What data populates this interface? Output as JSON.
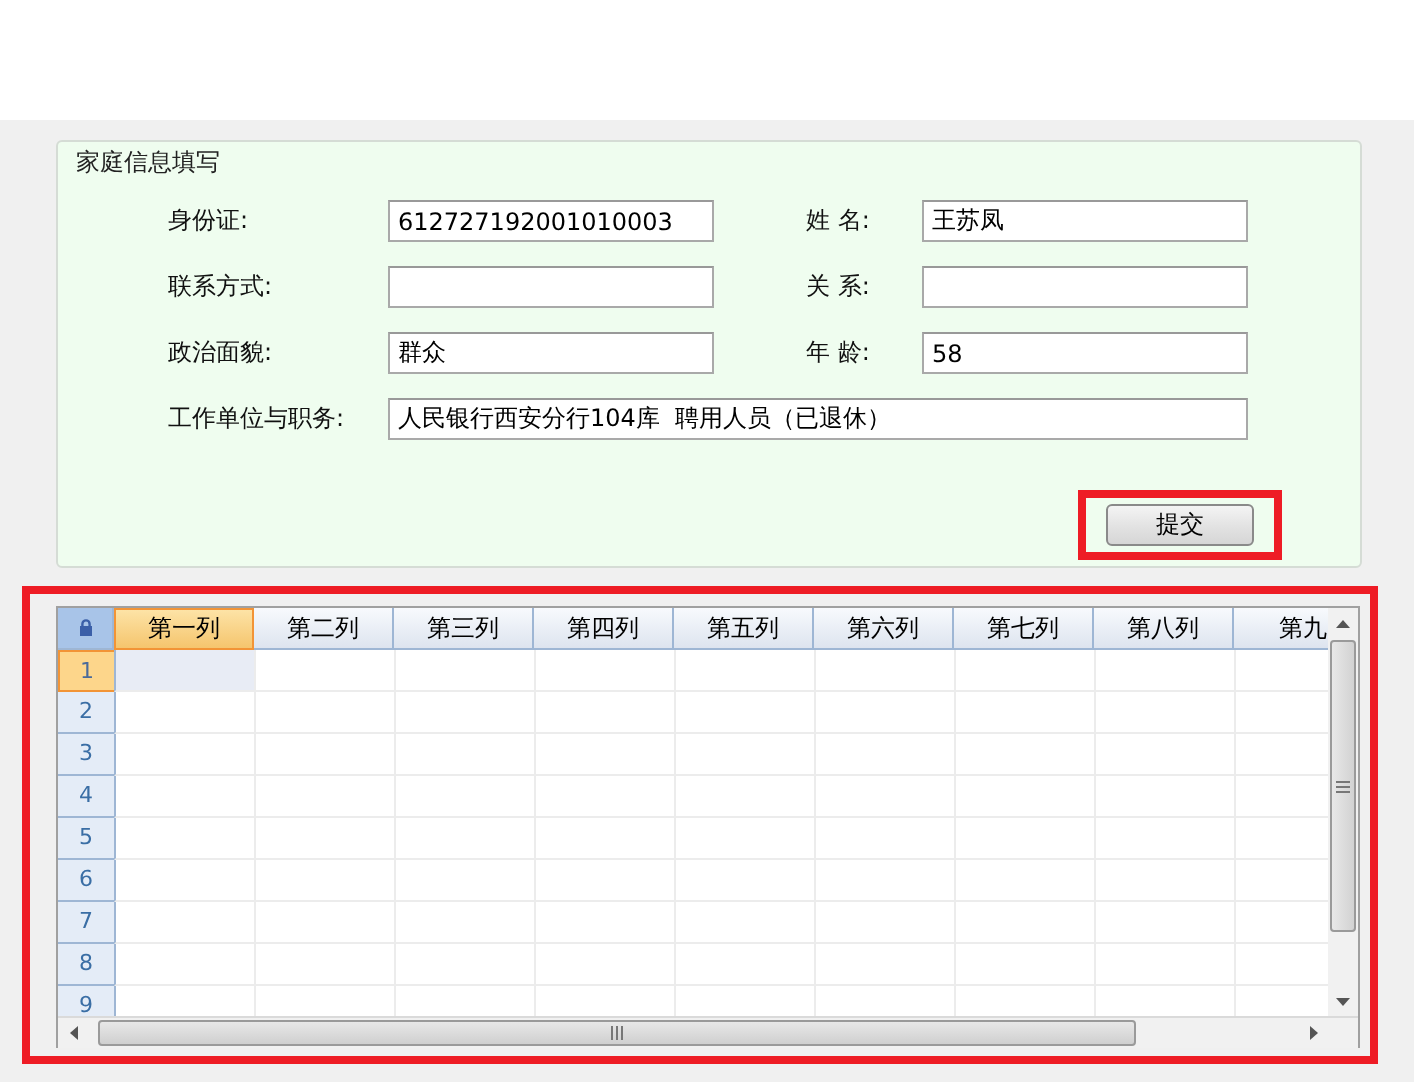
{
  "form": {
    "title": "家庭信息填写",
    "fields": [
      {
        "label": "身份证:",
        "value": "612727192001010003",
        "kind": "half"
      },
      {
        "label": "姓 名:",
        "value": "王苏凤",
        "kind": "half"
      },
      {
        "label": "联系方式:",
        "kind": "half"
      },
      {
        "label": "关 系:",
        "kind": "half"
      },
      {
        "label": "政治面貌:",
        "value": "群众",
        "kind": "half"
      },
      {
        "label": "年 龄:",
        "value": "58",
        "kind": "half"
      },
      {
        "label": "工作单位与职务:",
        "value": "人民银行西安分行104库  聘用人员（已退休）",
        "kind": "full"
      }
    ],
    "submit": {
      "label": "提交",
      "highlighted": true
    }
  },
  "grid": {
    "highlighted": true,
    "columns": [
      {
        "label": "第一列",
        "selected": true
      },
      {
        "label": "第二列",
        "selected": false
      },
      {
        "label": "第三列",
        "selected": false
      },
      {
        "label": "第四列",
        "selected": false
      },
      {
        "label": "第五列",
        "selected": false
      },
      {
        "label": "第六列",
        "selected": false
      },
      {
        "label": "第七列",
        "selected": false
      },
      {
        "label": "第八列",
        "selected": false
      },
      {
        "label": "第九",
        "selected": false
      }
    ],
    "rows": [
      {
        "label": "1",
        "selected": true
      },
      {
        "label": "2",
        "selected": false
      },
      {
        "label": "3",
        "selected": false
      },
      {
        "label": "4",
        "selected": false
      },
      {
        "label": "5",
        "selected": false
      },
      {
        "label": "6",
        "selected": false
      },
      {
        "label": "7",
        "selected": false
      },
      {
        "label": "8",
        "selected": false
      },
      {
        "label": "9",
        "selected": false
      }
    ]
  }
}
